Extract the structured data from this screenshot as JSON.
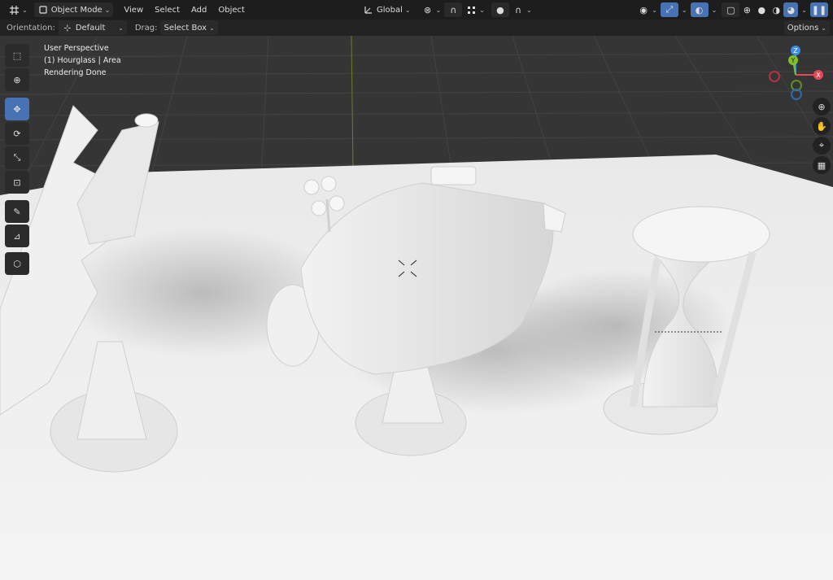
{
  "header": {
    "mode_label": "Object Mode",
    "menus": [
      "View",
      "Select",
      "Add",
      "Object"
    ],
    "transform_orientation": "Global"
  },
  "tool_settings": {
    "orientation_label": "Orientation:",
    "orientation_value": "Default",
    "drag_label": "Drag:",
    "drag_value": "Select Box",
    "options_label": "Options"
  },
  "viewport": {
    "info_lines": [
      "User Perspective",
      "(1) Hourglass | Area",
      "Rendering Done"
    ]
  },
  "gizmo": {
    "axes": [
      "Z",
      "Y",
      "X"
    ]
  },
  "colors": {
    "accent": "#4772b3",
    "axis_x": "#e74856",
    "axis_y": "#7fbf2a",
    "axis_z": "#3d8ee6"
  }
}
